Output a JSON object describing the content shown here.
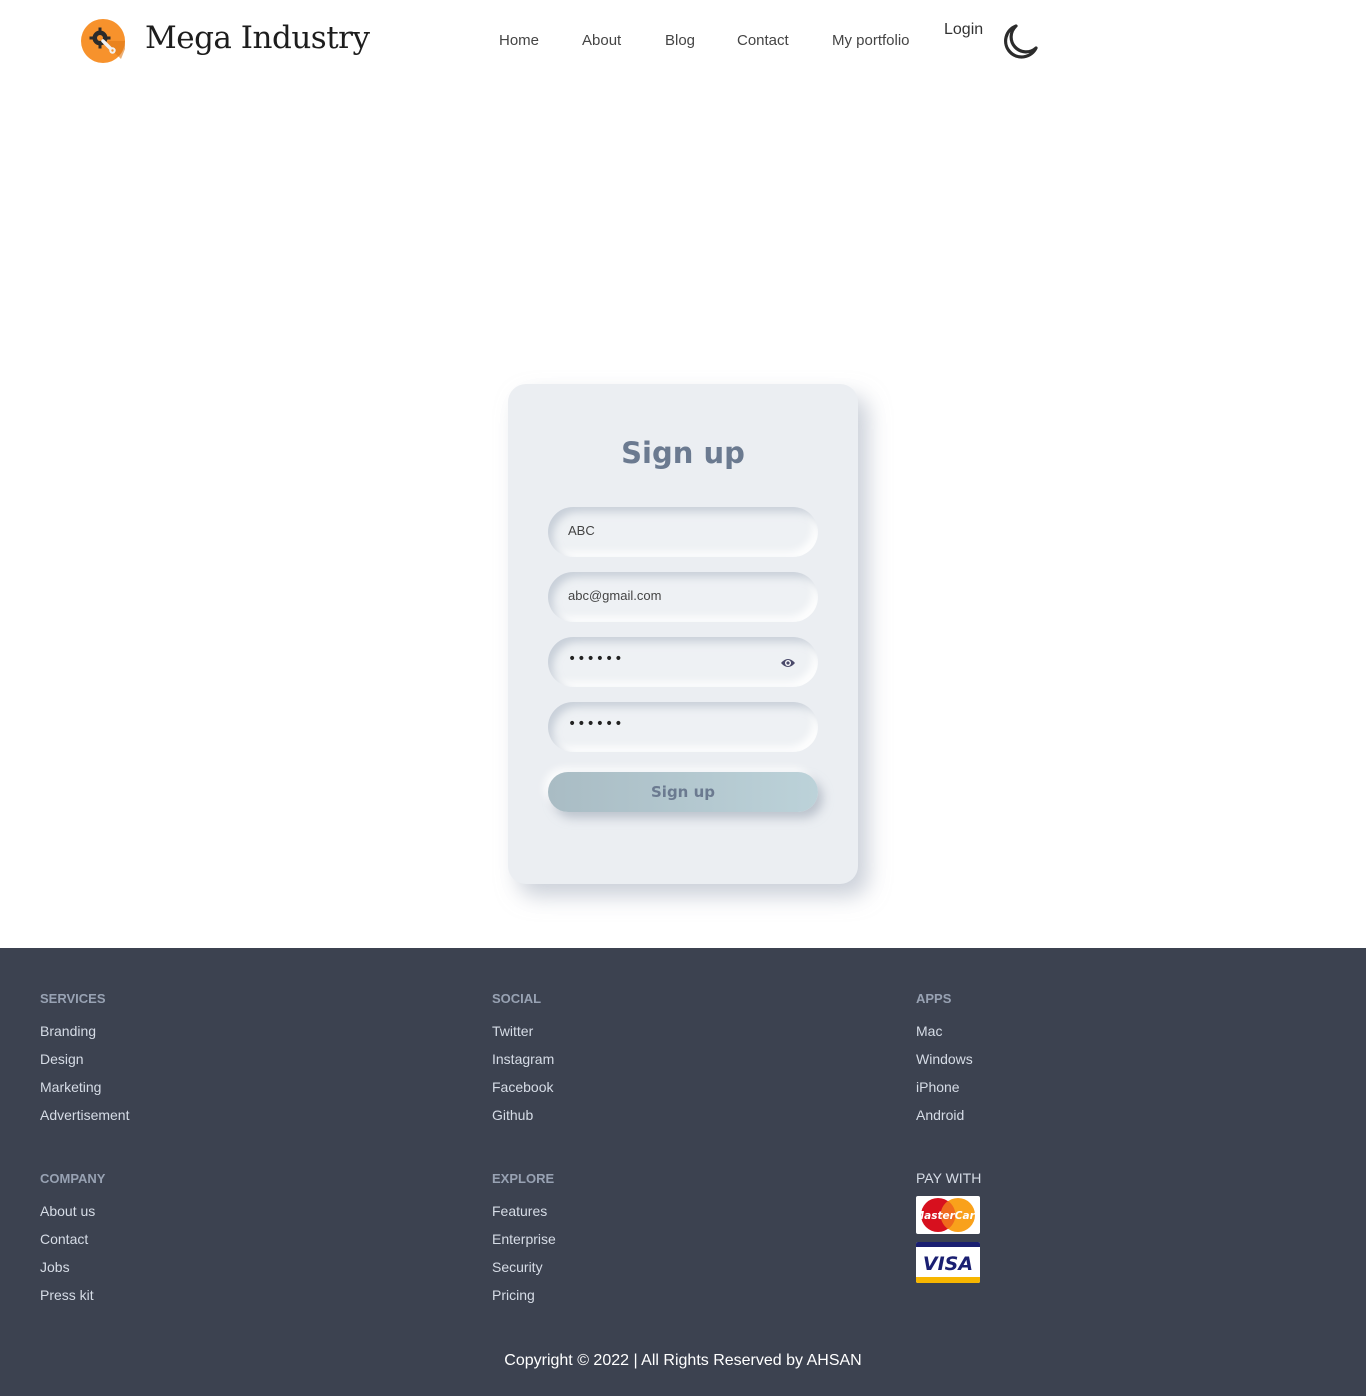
{
  "header": {
    "brand": "Mega Industry",
    "nav": [
      "Home",
      "About",
      "Blog",
      "Contact",
      "My portfolio"
    ],
    "login": "Login",
    "logo_icon": "gear-wrench-icon",
    "theme_icon": "moon-icon"
  },
  "signup": {
    "title": "Sign up",
    "name_value": "ABC",
    "email_value": "abc@gmail.com",
    "password_value": "••••••",
    "confirm_value": "••••••",
    "button_label": "Sign up"
  },
  "footer": {
    "services": {
      "heading": "SERVICES",
      "links": [
        "Branding",
        "Design",
        "Marketing",
        "Advertisement"
      ]
    },
    "social": {
      "heading": "SOCIAL",
      "links": [
        "Twitter",
        "Instagram",
        "Facebook",
        "Github"
      ]
    },
    "apps": {
      "heading": "APPS",
      "links": [
        "Mac",
        "Windows",
        "iPhone",
        "Android"
      ]
    },
    "company": {
      "heading": "COMPANY",
      "links": [
        "About us",
        "Contact",
        "Jobs",
        "Press kit"
      ]
    },
    "explore": {
      "heading": "EXPLORE",
      "links": [
        "Features",
        "Enterprise",
        "Security",
        "Pricing"
      ]
    },
    "pay_with": "PAY WITH",
    "mastercard_text": "MasterCard",
    "visa_text": "VISA",
    "copyright": "Copyright © 2022 | All Rights Reserved by AHSAN"
  },
  "colors": {
    "accent_orange": "#f7922c",
    "card_bg": "#ebeef2",
    "title_color": "#6b7a90",
    "footer_bg": "#3c4250"
  }
}
